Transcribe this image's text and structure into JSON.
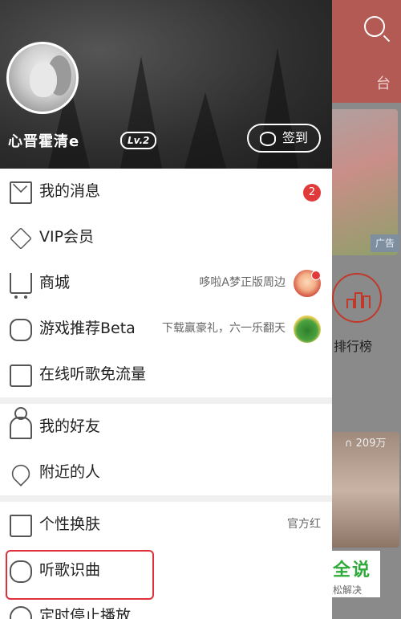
{
  "background_app": {
    "radio_label_partial": "台",
    "ad_label": "广告",
    "ranking_label": "排行榜",
    "play_count": "209万"
  },
  "watermark": {
    "title": "百科全说",
    "subtitle": "助你轻松解决"
  },
  "profile": {
    "username": "心晋霍清e",
    "level": "Lv.2",
    "signin_label": "签到"
  },
  "menu": {
    "section1": [
      {
        "label": "我的消息",
        "badge": "2",
        "icon": "mail-icon"
      },
      {
        "label": "VIP会员",
        "icon": "vip-diamond-icon"
      },
      {
        "label": "商城",
        "subtext": "哆啦A梦正版周边",
        "icon": "cart-icon"
      },
      {
        "label": "游戏推荐Beta",
        "subtext": "下载赢豪礼，六一乐翻天",
        "icon": "gamepad-icon"
      },
      {
        "label": "在线听歌免流量",
        "icon": "sim-card-icon"
      }
    ],
    "section2": [
      {
        "label": "我的好友",
        "icon": "person-icon"
      },
      {
        "label": "附近的人",
        "icon": "location-pin-icon"
      }
    ],
    "section3": [
      {
        "label": "个性换肤",
        "subtext": "官方红",
        "icon": "tshirt-icon"
      },
      {
        "label": "听歌识曲",
        "icon": "mic-icon"
      },
      {
        "label": "定时停止播放",
        "icon": "timer-icon"
      }
    ]
  },
  "colors": {
    "accent_red": "#e03a3a",
    "watermark_green": "#2eaa38"
  }
}
